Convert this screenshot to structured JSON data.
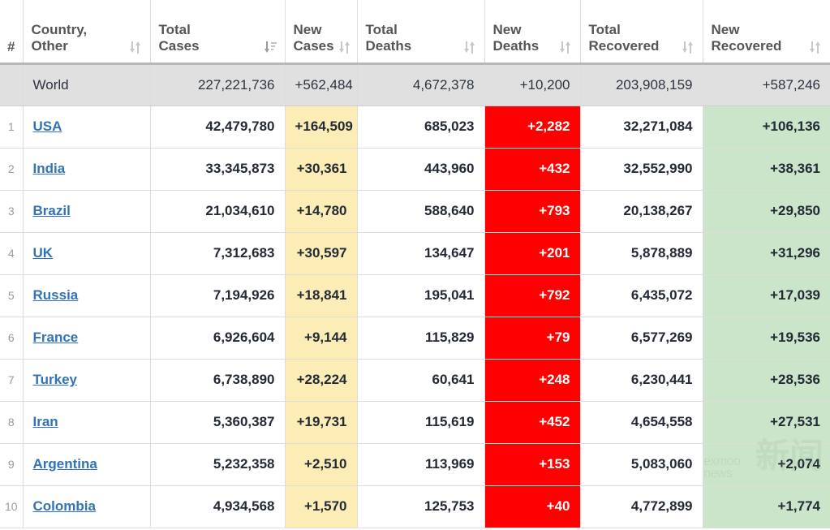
{
  "table": {
    "columns": [
      {
        "key": "rank",
        "label": "#",
        "sort_icon": "sort-neutral-icon",
        "has_icon": false
      },
      {
        "key": "country",
        "label": "Country,\nOther",
        "sort_icon": "sort-neutral-icon",
        "has_icon": true
      },
      {
        "key": "total_cases",
        "label": "Total\nCases",
        "sort_icon": "sort-descending-active-icon",
        "has_icon": true
      },
      {
        "key": "new_cases",
        "label": "New\nCases",
        "sort_icon": "sort-neutral-icon",
        "has_icon": true
      },
      {
        "key": "total_deaths",
        "label": "Total\nDeaths",
        "sort_icon": "sort-neutral-icon",
        "has_icon": true
      },
      {
        "key": "new_deaths",
        "label": "New\nDeaths",
        "sort_icon": "sort-neutral-icon",
        "has_icon": true
      },
      {
        "key": "total_recovered",
        "label": "Total\nRecovered",
        "sort_icon": "sort-neutral-icon",
        "has_icon": true
      },
      {
        "key": "new_recovered",
        "label": "New\nRecovered",
        "sort_icon": "sort-neutral-icon",
        "has_icon": true
      }
    ],
    "headers": {
      "rank": "#",
      "country_line1": "Country,",
      "country_line2": "Other",
      "total_cases_line1": "Total",
      "total_cases_line2": "Cases",
      "new_cases_line1": "New",
      "new_cases_line2": "Cases",
      "total_deaths_line1": "Total",
      "total_deaths_line2": "Deaths",
      "new_deaths_line1": "New",
      "new_deaths_line2": "Deaths",
      "total_recovered_line1": "Total",
      "total_recovered_line2": "Recovered",
      "new_recovered_line1": "New",
      "new_recovered_line2": "Recovered"
    },
    "world_row": {
      "rank": "",
      "country": "World",
      "total_cases": "227,221,736",
      "new_cases": "+562,484",
      "total_deaths": "4,672,378",
      "new_deaths": "+10,200",
      "total_recovered": "203,908,159",
      "new_recovered": "+587,246"
    },
    "rows": [
      {
        "rank": "1",
        "country": "USA",
        "total_cases": "42,479,780",
        "new_cases": "+164,509",
        "total_deaths": "685,023",
        "new_deaths": "+2,282",
        "total_recovered": "32,271,084",
        "new_recovered": "+106,136"
      },
      {
        "rank": "2",
        "country": "India",
        "total_cases": "33,345,873",
        "new_cases": "+30,361",
        "total_deaths": "443,960",
        "new_deaths": "+432",
        "total_recovered": "32,552,990",
        "new_recovered": "+38,361"
      },
      {
        "rank": "3",
        "country": "Brazil",
        "total_cases": "21,034,610",
        "new_cases": "+14,780",
        "total_deaths": "588,640",
        "new_deaths": "+793",
        "total_recovered": "20,138,267",
        "new_recovered": "+29,850"
      },
      {
        "rank": "4",
        "country": "UK",
        "total_cases": "7,312,683",
        "new_cases": "+30,597",
        "total_deaths": "134,647",
        "new_deaths": "+201",
        "total_recovered": "5,878,889",
        "new_recovered": "+31,296"
      },
      {
        "rank": "5",
        "country": "Russia",
        "total_cases": "7,194,926",
        "new_cases": "+18,841",
        "total_deaths": "195,041",
        "new_deaths": "+792",
        "total_recovered": "6,435,072",
        "new_recovered": "+17,039"
      },
      {
        "rank": "6",
        "country": "France",
        "total_cases": "6,926,604",
        "new_cases": "+9,144",
        "total_deaths": "115,829",
        "new_deaths": "+79",
        "total_recovered": "6,577,269",
        "new_recovered": "+19,536"
      },
      {
        "rank": "7",
        "country": "Turkey",
        "total_cases": "6,738,890",
        "new_cases": "+28,224",
        "total_deaths": "60,641",
        "new_deaths": "+248",
        "total_recovered": "6,230,441",
        "new_recovered": "+28,536"
      },
      {
        "rank": "8",
        "country": "Iran",
        "total_cases": "5,360,387",
        "new_cases": "+19,731",
        "total_deaths": "115,619",
        "new_deaths": "+452",
        "total_recovered": "4,654,558",
        "new_recovered": "+27,531"
      },
      {
        "rank": "9",
        "country": "Argentina",
        "total_cases": "5,232,358",
        "new_cases": "+2,510",
        "total_deaths": "113,969",
        "new_deaths": "+153",
        "total_recovered": "5,083,060",
        "new_recovered": "+2,074"
      },
      {
        "rank": "10",
        "country": "Colombia",
        "total_cases": "4,934,568",
        "new_cases": "+1,570",
        "total_deaths": "125,753",
        "new_deaths": "+40",
        "total_recovered": "4,772,899",
        "new_recovered": "+1,774"
      }
    ]
  },
  "watermark": {
    "line1": "exmoo",
    "line2": "news",
    "glyphs": "新闻"
  },
  "colors": {
    "new_cases_bg": "#fcedb6",
    "new_deaths_bg": "#ff0000",
    "new_recovered_bg": "#cbe5cb",
    "world_row_bg": "#e0e0e0",
    "link": "#3273b5",
    "header_text": "#555555",
    "body_text": "#232a35",
    "border": "#dddddd"
  }
}
